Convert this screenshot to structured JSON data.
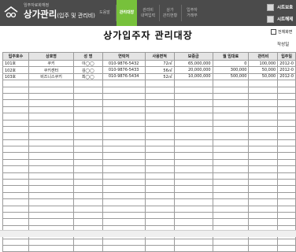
{
  "header": {
    "subtitle": "임주자료화재정",
    "title_main": "상가관리",
    "title_paren": "(입주 및 관리비)",
    "tabs": [
      {
        "label": "도움말"
      },
      {
        "label": "관리대장"
      },
      {
        "label": "관리비\n내역입력"
      },
      {
        "label": "상가\n관리현황"
      },
      {
        "label": "입주자\n거래부"
      }
    ],
    "sheet_buttons": [
      {
        "label": "시트보호"
      },
      {
        "label": "시트해제"
      }
    ]
  },
  "page": {
    "title": "상가입주자 관리대장",
    "checkbox_label": "전체화면",
    "writer_label": "작성일"
  },
  "table": {
    "columns": [
      "입주호수",
      "상호명",
      "성 명",
      "연락처",
      "사용면적",
      "보증금",
      "월 임대료",
      "관리비",
      "입주일"
    ],
    "rows": [
      [
        "101호",
        "쿠키",
        "이◯◯",
        "010-9876-5432",
        "72㎡",
        "65,000,000",
        "0",
        "100,000",
        "2012-0"
      ],
      [
        "102호",
        "쿠키센터",
        "김◯◯",
        "010-9876-5433",
        "56㎡",
        "20,000,000",
        "300,000",
        "50,000",
        "2012-0"
      ],
      [
        "103호",
        "비즈니스쿠키",
        "최◯◯",
        "010-9876-5434",
        "52㎡",
        "10,000,000",
        "500,000",
        "50,000",
        "2012-0"
      ]
    ]
  },
  "colors": {
    "topbar": "#4b4b4b",
    "accent": "#77c13b",
    "header_cell": "#e4e4e4",
    "grid": "#9b9b9b"
  },
  "icons": {
    "logo": "house-logo-icon",
    "checkbox": "checkbox-icon"
  }
}
